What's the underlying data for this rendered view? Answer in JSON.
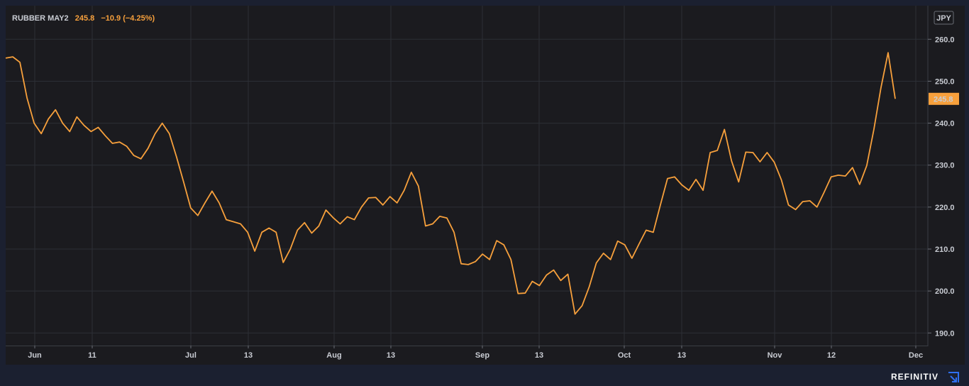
{
  "header": {
    "symbol": "RUBBER MAY2",
    "last": "245.8",
    "change": "−10.9 (−4.25%)"
  },
  "currency": "JPY",
  "brand": "REFINITIV",
  "colors": {
    "background": "#1b1b1f",
    "frame": "#1b2030",
    "line": "#f7a03c",
    "grid": "#2c2f36",
    "price_badge": "#f7a03c",
    "label_text": "#c9ccd3"
  },
  "icons": {
    "brand": "refinitiv-logo-icon"
  },
  "chart_data": {
    "type": "line",
    "series": [
      {
        "values": [
          255.5,
          255.8,
          254.5,
          246,
          240,
          237.5,
          241,
          243.2,
          240,
          238,
          241.5,
          239.5,
          238,
          239,
          237,
          235.2,
          235.5,
          234.5,
          232.3,
          231.5,
          234,
          237.5,
          240,
          237.5,
          232,
          226,
          219.8,
          218,
          221,
          223.8,
          221,
          217,
          216.5,
          216,
          214,
          209.5,
          214,
          215,
          214,
          206.8,
          210,
          214.5,
          216.3,
          213.8,
          215.5,
          219.3,
          217.5,
          216,
          217.7,
          217,
          220,
          222.2,
          222.3,
          220.5,
          222.5,
          221,
          224,
          228.3,
          225,
          215.5,
          216,
          217.8,
          217.4,
          214,
          206.5,
          206.3,
          207,
          208.8,
          207.5,
          212,
          211,
          207.5,
          199.4,
          199.5,
          202.3,
          201.3,
          203.8,
          205,
          202.5,
          204,
          194.5,
          196.5,
          201,
          206.7,
          209,
          207.5,
          211.9,
          211,
          207.8,
          211.2,
          214.5,
          214,
          220.5,
          226.8,
          227.2,
          225.3,
          224,
          226.6,
          224,
          233,
          233.5,
          238.5,
          231,
          226,
          233.1,
          233,
          230.8,
          233,
          230.7,
          226.5,
          220.5,
          219.4,
          221.3,
          221.5,
          220,
          223.5,
          227.2,
          227.6,
          227.4,
          229.4,
          225.4,
          229.9,
          238.5,
          248.5,
          256.8,
          245.8
        ]
      }
    ],
    "x_tick_labels": [
      "Jun",
      "11",
      "Jul",
      "13",
      "Aug",
      "13",
      "Sep",
      "13",
      "Oct",
      "13",
      "Nov",
      "12",
      "Dec"
    ],
    "y_tick_labels": [
      "190.0",
      "200.0",
      "210.0",
      "220.0",
      "230.0",
      "240.0",
      "250.0",
      "260.0"
    ],
    "ylim": [
      187,
      268
    ],
    "last_value_label": "245.8",
    "grid": true,
    "scale": "linear"
  }
}
